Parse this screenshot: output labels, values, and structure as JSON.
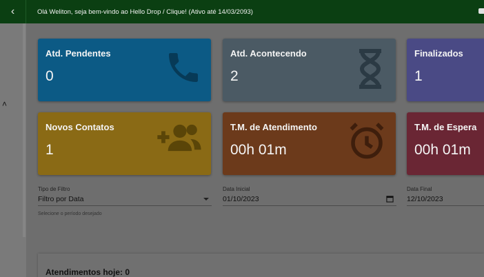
{
  "header": {
    "welcome_text": "Olá Weliton, seja bem-vindo ao Hello Drop / Clique! (Ativo até 14/03/2093)"
  },
  "cards": [
    {
      "title": "Atd. Pendentes",
      "value": "0",
      "icon": "phone-icon"
    },
    {
      "title": "Atd. Acontecendo",
      "value": "2",
      "icon": "hourglass-icon"
    },
    {
      "title": "Finalizados",
      "value": "1",
      "icon": "check-icon"
    },
    {
      "title": "Novos Contatos",
      "value": "1",
      "icon": "add-group-icon"
    },
    {
      "title": "T.M. de Atendimento",
      "value": "00h 01m",
      "icon": "alarm-clock-icon"
    },
    {
      "title": "T.M. de Espera",
      "value": "00h 01m",
      "icon": "clock-icon"
    }
  ],
  "filters": {
    "filter_type": {
      "label": "Tipo de Filtro",
      "value": "Filtro por Data",
      "hint": "Selecione o período desejado"
    },
    "start_date": {
      "label": "Data Inicial",
      "value": "01/10/2023"
    },
    "end_date": {
      "label": "Data Final",
      "value": "12/10/2023"
    }
  },
  "today": {
    "title": "Atendimentos hoje: 0"
  },
  "colors": {
    "topbar": "#0b3f12",
    "card_pendentes": "#0c5a85",
    "card_acontecendo": "#4b5a64",
    "card_finalizados": "#4a4a85",
    "card_novos": "#8a6a15",
    "card_tm_atendimento": "#6c3a1b",
    "card_tm_espera": "#6a2634"
  }
}
